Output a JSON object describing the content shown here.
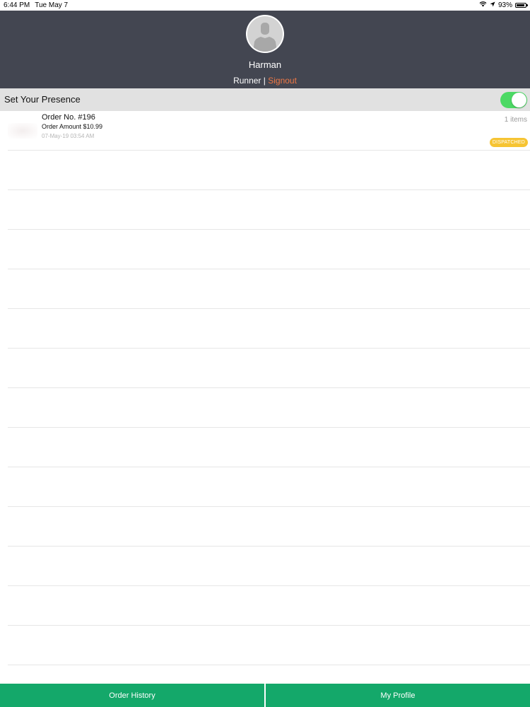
{
  "status_bar": {
    "time": "6:44 PM",
    "date": "Tue May 7",
    "battery": "93%",
    "battery_level": 0.93
  },
  "header": {
    "user_name": "Harman",
    "role": "Runner",
    "separator": "|",
    "signout_label": "Signout",
    "background_color": "#434651",
    "signout_color": "#f07845"
  },
  "presence": {
    "label": "Set Your Presence",
    "enabled": true,
    "toggle_color": "#4cd964"
  },
  "orders": [
    {
      "number": "Order No. #196",
      "amount": "Order Amount $10.99",
      "date": "07-May-19 03:54 AM",
      "items": "1 items",
      "status": "DISPATCHED"
    }
  ],
  "tab_bar": {
    "order_history_label": "Order History",
    "my_profile_label": "My Profile",
    "color": "#14a86a"
  },
  "icons": {
    "wifi": "wifi-icon",
    "location": "location-arrow-icon",
    "battery": "battery-icon",
    "avatar": "avatar-placeholder-icon"
  }
}
